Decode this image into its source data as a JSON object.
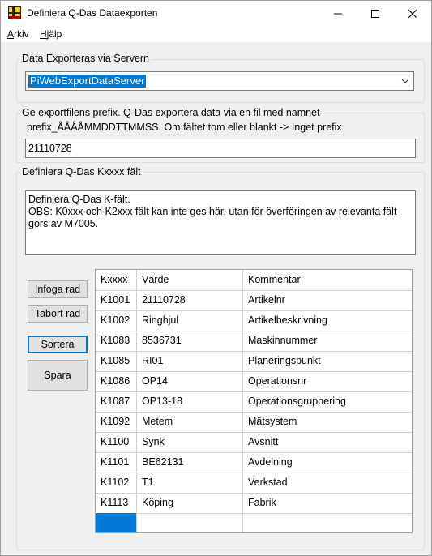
{
  "window": {
    "title": "Definiera Q-Das Dataexporten",
    "icon": "flag-app-icon"
  },
  "menu": {
    "arkiv_u": "A",
    "arkiv_rest": "rkiv",
    "hjalp_u": "H",
    "hjalp_rest": "jälp"
  },
  "server": {
    "group_label": "Data Exporteras via Servern",
    "selected": "PiWebExportDataServer"
  },
  "prefix": {
    "group_label": "Ge exportfilens prefix. Q-Das exportera data via en fil med namnet",
    "description": "prefix_ÅÅÅÅMMDDTTMMSS.  Om fältet tom eller blankt -> Inget prefix",
    "value": "21110728"
  },
  "kfields": {
    "group_label": "Definiera Q-Das Kxxxx fält",
    "info_line1": "Definiera Q-Das K-fält.",
    "info_line2": "OBS: K0xxx och K2xxx fält kan inte ges här, utan för överföringen av relevanta fält görs av M7005."
  },
  "buttons": {
    "infoga": "Infoga rad",
    "tabort": "Tabort rad",
    "sortera": "Sortera",
    "spara": "Spara"
  },
  "grid": {
    "headers": [
      "Kxxxx",
      "Värde",
      "Kommentar"
    ],
    "rows": [
      [
        "K1001",
        "21110728",
        "Artikelnr"
      ],
      [
        "K1002",
        "Ringhjul",
        "Artikelbeskrivning"
      ],
      [
        "K1083",
        "8536731",
        "Maskinnummer"
      ],
      [
        "K1085",
        "RI01",
        "Planeringspunkt"
      ],
      [
        "K1086",
        "OP14",
        "Operationsnr"
      ],
      [
        "K1087",
        "OP13-18",
        "Operationsgruppering"
      ],
      [
        "K1092",
        "Metem",
        "Mätsystem"
      ],
      [
        "K1100",
        "Synk",
        "Avsnitt"
      ],
      [
        "K1101",
        "BE62131",
        "Avdelning"
      ],
      [
        "K1102",
        "T1",
        "Verkstad"
      ],
      [
        "K1113",
        "Köping",
        "Fabrik"
      ]
    ]
  },
  "colors": {
    "selection": "#0078d7"
  }
}
